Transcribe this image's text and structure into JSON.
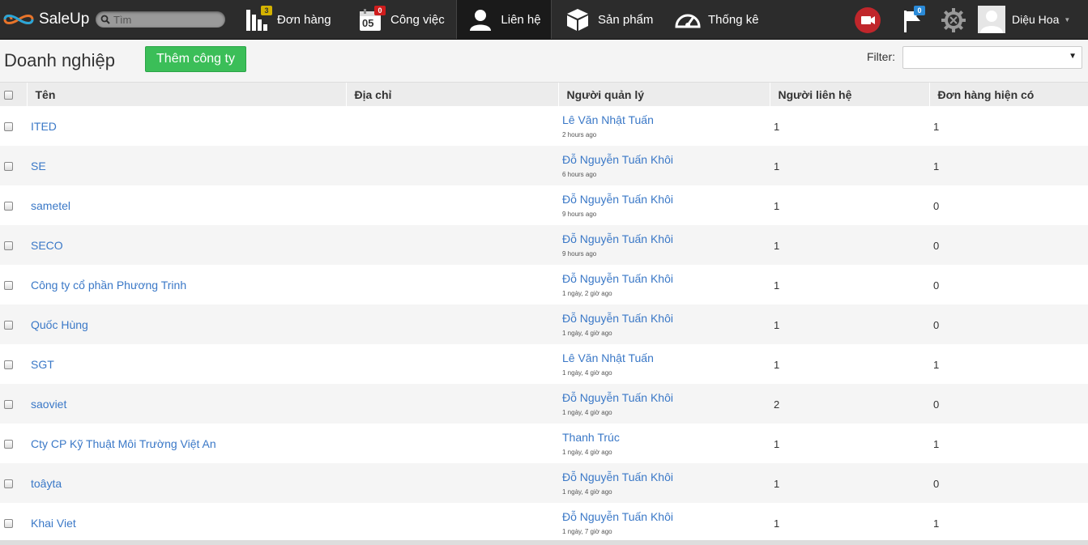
{
  "app": {
    "name": "SaleUp"
  },
  "search": {
    "placeholder": "Tìm"
  },
  "nav": [
    {
      "label": "Đơn hàng",
      "icon": "orders-bars-icon",
      "badge": "3"
    },
    {
      "label": "Công việc",
      "icon": "calendar-icon",
      "badge": "0",
      "calendar_day": "05"
    },
    {
      "label": "Liên hệ",
      "icon": "contact-person-icon",
      "active": true
    },
    {
      "label": "Sản phẩm",
      "icon": "product-box-icon"
    },
    {
      "label": "Thống kê",
      "icon": "dashboard-gauge-icon"
    }
  ],
  "toolbar": {
    "flag_badge": "0"
  },
  "user": {
    "name": "Diệu Hoa"
  },
  "page": {
    "title": "Doanh nghiệp",
    "add_button": "Thêm công ty",
    "filter_label": "Filter:",
    "filter_value": ""
  },
  "table": {
    "headers": [
      "Tên",
      "Địa chỉ",
      "Người quản lý",
      "Người liên hệ",
      "Đơn hàng hiện có"
    ],
    "rows": [
      {
        "name": "ITED",
        "address": "",
        "manager": "Lê Văn Nhật Tuấn",
        "time": "2 hours ago",
        "contacts": "1",
        "orders": "1"
      },
      {
        "name": "SE",
        "address": "",
        "manager": "Đỗ Nguyễn Tuấn Khôi",
        "time": "6 hours ago",
        "contacts": "1",
        "orders": "1"
      },
      {
        "name": "sametel",
        "address": "",
        "manager": "Đỗ Nguyễn Tuấn Khôi",
        "time": "9 hours ago",
        "contacts": "1",
        "orders": "0"
      },
      {
        "name": "SECO",
        "address": "",
        "manager": "Đỗ Nguyễn Tuấn Khôi",
        "time": "9 hours ago",
        "contacts": "1",
        "orders": "0"
      },
      {
        "name": "Công ty cổ phần Phương Trinh",
        "address": "",
        "manager": "Đỗ Nguyễn Tuấn Khôi",
        "time": "1 ngày, 2 giờ ago",
        "contacts": "1",
        "orders": "0"
      },
      {
        "name": "Quốc Hùng",
        "address": "",
        "manager": "Đỗ Nguyễn Tuấn Khôi",
        "time": "1 ngày, 4 giờ ago",
        "contacts": "1",
        "orders": "0"
      },
      {
        "name": "SGT",
        "address": "",
        "manager": "Lê Văn Nhật Tuấn",
        "time": "1 ngày, 4 giờ ago",
        "contacts": "1",
        "orders": "1"
      },
      {
        "name": "saoviet",
        "address": "",
        "manager": "Đỗ Nguyễn Tuấn Khôi",
        "time": "1 ngày, 4 giờ ago",
        "contacts": "2",
        "orders": "0"
      },
      {
        "name": "Cty CP Kỹ Thuật Môi Trường Việt An",
        "address": "",
        "manager": "Thanh Trúc",
        "time": "1 ngày, 4 giờ ago",
        "contacts": "1",
        "orders": "1"
      },
      {
        "name": "toâyta",
        "address": "",
        "manager": "Đỗ Nguyễn Tuấn Khôi",
        "time": "1 ngày, 4 giờ ago",
        "contacts": "1",
        "orders": "0"
      },
      {
        "name": "Khai Viet",
        "address": "",
        "manager": "Đỗ Nguyễn Tuấn Khôi",
        "time": "1 ngày, 7 giờ ago",
        "contacts": "1",
        "orders": "1"
      }
    ]
  }
}
